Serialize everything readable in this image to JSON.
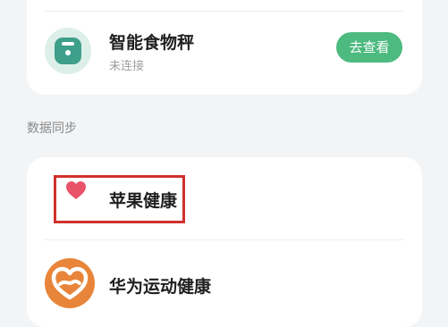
{
  "devices": [
    {
      "name": "智能食物秤",
      "status": "未连接",
      "action_label": "去查看",
      "icon": "food-scale-icon"
    }
  ],
  "data_sync": {
    "section_title": "数据同步",
    "items": [
      {
        "label": "苹果健康",
        "icon": "heart-icon",
        "highlighted": true
      },
      {
        "label": "华为运动健康",
        "icon": "huawei-health-icon",
        "highlighted": false
      }
    ]
  },
  "colors": {
    "accent_green": "#4dba7f",
    "scale_teal": "#3e9f8b",
    "heart_red": "#e9536a",
    "huawei_orange": "#e8853a",
    "highlight_red": "#d0312d"
  }
}
